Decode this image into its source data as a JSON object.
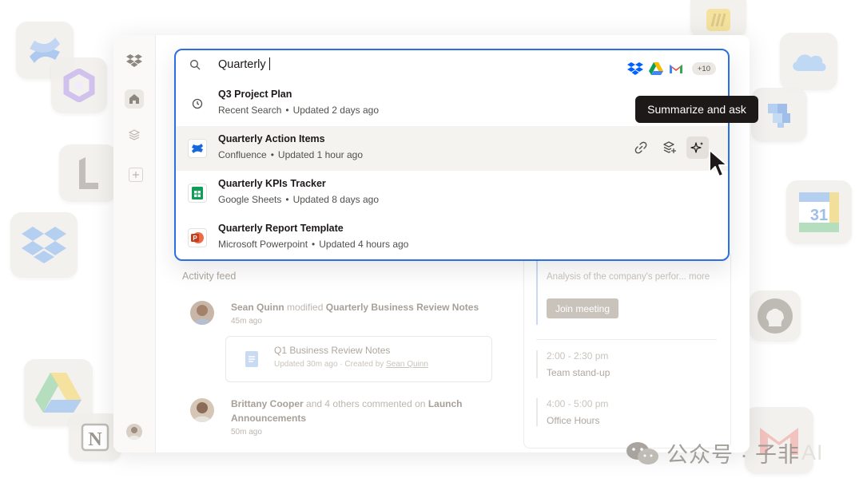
{
  "search": {
    "query": "Quarterly",
    "more_sources": "+10"
  },
  "results": [
    {
      "title": "Q3 Project Plan",
      "source": "Recent Search",
      "updated": "Updated 2 days ago"
    },
    {
      "title": "Quarterly Action Items",
      "source": "Confluence",
      "updated": "Updated 1 hour ago"
    },
    {
      "title": "Quarterly KPIs Tracker",
      "source": "Google Sheets",
      "updated": "Updated 8 days ago"
    },
    {
      "title": "Quarterly Report Template",
      "source": "Microsoft Powerpoint",
      "updated": "Updated 4 hours ago"
    }
  ],
  "tooltip": "Summarize and ask",
  "activity": {
    "title": "Activity feed",
    "entries": [
      {
        "user": "Sean Quinn",
        "action": "modified",
        "target": "Quarterly Business Review Notes",
        "time": "45m ago"
      },
      {
        "user": "Brittany Cooper",
        "action": "and 4 others commented on",
        "target": "Launch Announcements",
        "time": "50m ago"
      }
    ],
    "card": {
      "title": "Q1 Business Review Notes",
      "meta_prefix": "Updated 30m ago · Created by",
      "author": "Sean Quinn"
    }
  },
  "calendar": {
    "summary": "Analysis of the company's perfor...",
    "more": "more",
    "join_label": "Join meeting",
    "events": [
      {
        "time": "2:00 - 2:30 pm",
        "name": "Team stand-up"
      },
      {
        "time": "4:00 - 5:00 pm",
        "name": "Office Hours"
      }
    ]
  },
  "watermark": {
    "text": "公众号 · 子非",
    "suffix": "AI"
  },
  "icons": [
    "dropbox-icon",
    "home-icon",
    "layers-icon",
    "plus-icon",
    "search-icon",
    "clock-icon",
    "confluence-icon",
    "google-sheets-icon",
    "powerpoint-icon",
    "google-drive-icon",
    "gmail-icon",
    "link-icon",
    "stack-plus-icon",
    "sparkle-icon",
    "cursor-icon"
  ],
  "colors": {
    "accent": "#2b6fe3",
    "tooltip_bg": "#1e1919",
    "dropbox": "#0061fe"
  }
}
